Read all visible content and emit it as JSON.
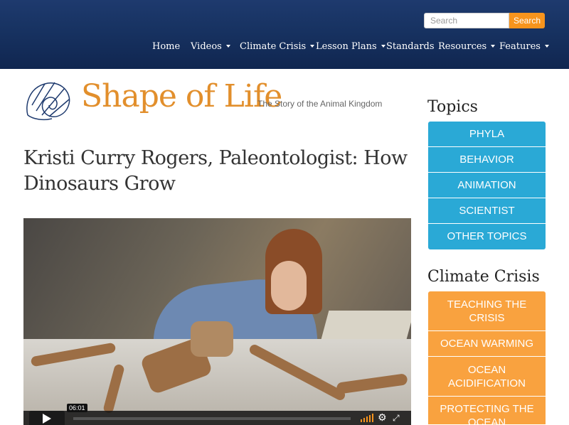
{
  "search": {
    "placeholder": "Search",
    "button_label": "Search"
  },
  "nav": {
    "items": [
      {
        "label": "Home",
        "has_dropdown": false
      },
      {
        "label": "Videos",
        "has_dropdown": true
      },
      {
        "label": "Climate Crisis",
        "has_dropdown": true
      },
      {
        "label": "Lesson Plans",
        "has_dropdown": true
      },
      {
        "label": "Standards",
        "has_dropdown": false
      },
      {
        "label": "Resources",
        "has_dropdown": true
      },
      {
        "label": "Features",
        "has_dropdown": true
      }
    ]
  },
  "logo": {
    "wordmark": "Shape of Life",
    "tagline": "The Story of the Animal Kingdom",
    "icon": "nautilus-shell-icon"
  },
  "page": {
    "title": "Kristi Curry Rogers, Paleontologist: How Dinosaurs Grow"
  },
  "video": {
    "time": "06:01",
    "icons": [
      "play-icon",
      "volume-icon",
      "gear-icon",
      "fullscreen-icon"
    ]
  },
  "sidebar": {
    "topics_heading": "Topics",
    "topics": [
      "PHYLA",
      "BEHAVIOR",
      "ANIMATION",
      "SCIENTIST",
      "OTHER TOPICS"
    ],
    "climate_heading": "Climate Crisis",
    "climate": [
      "TEACHING THE CRISIS",
      "OCEAN WARMING",
      "OCEAN ACIDIFICATION",
      "PROTECTING THE OCEAN"
    ]
  },
  "colors": {
    "header_bg": "#173261",
    "accent_orange": "#f7941d",
    "topics_blue": "#2aa9d6",
    "climate_orange": "#f9a23f",
    "logo_orange": "#e28f2c"
  }
}
